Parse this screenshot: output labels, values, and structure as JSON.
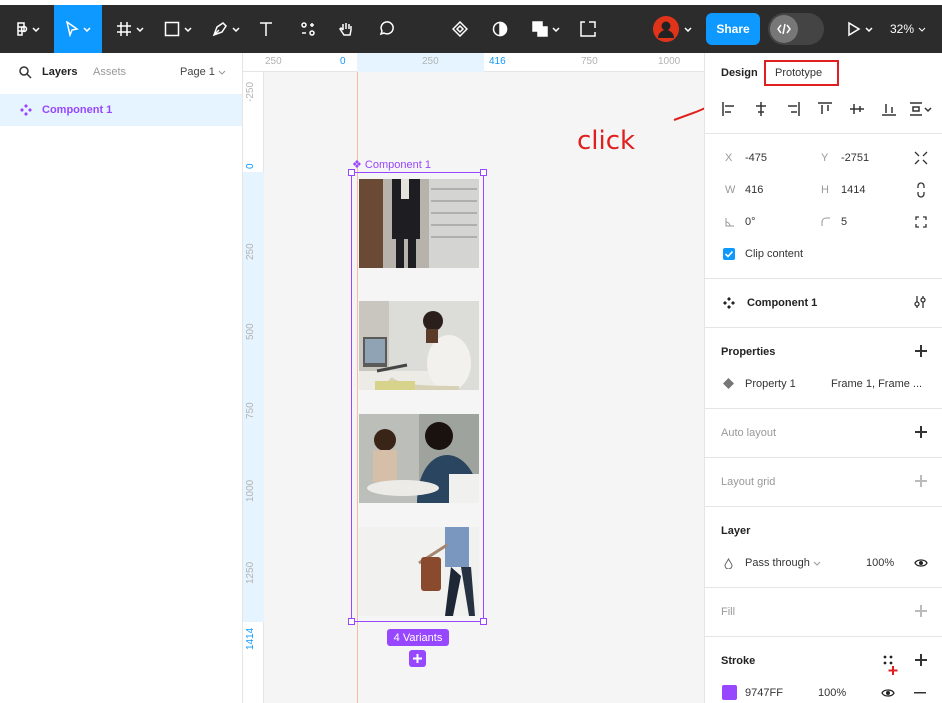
{
  "toolbar": {
    "share_label": "Share",
    "zoom": "32%"
  },
  "left_panel": {
    "tabs": {
      "layers": "Layers",
      "assets": "Assets"
    },
    "page": "Page 1",
    "layers": [
      {
        "label": "Component 1"
      }
    ]
  },
  "rulers": {
    "top": [
      "250",
      "0",
      "250",
      "416",
      "750",
      "1000"
    ],
    "left": [
      "-250",
      "0",
      "250",
      "500",
      "750",
      "1000",
      "1250",
      "1414"
    ]
  },
  "canvas": {
    "component_label": "Component 1",
    "variants_label": "4 Variants"
  },
  "annotation": {
    "text": "click",
    "color": "#e02020"
  },
  "right_panel": {
    "tabs": {
      "design": "Design",
      "prototype": "Prototype"
    },
    "frame": {
      "x_label": "X",
      "x": "-475",
      "y_label": "Y",
      "y": "-2751",
      "w_label": "W",
      "w": "416",
      "h_label": "H",
      "h": "1414",
      "rotation": "0°",
      "radius": "5",
      "clip_content": "Clip content"
    },
    "component": {
      "name": "Component 1"
    },
    "properties": {
      "title": "Properties",
      "items": [
        {
          "name": "Property 1",
          "value": "Frame 1, Frame ..."
        }
      ]
    },
    "auto_layout": "Auto layout",
    "layout_grid": "Layout grid",
    "layer": {
      "title": "Layer",
      "blend": "Pass through",
      "opacity": "100%"
    },
    "fill": "Fill",
    "stroke": {
      "title": "Stroke",
      "color": "9747FF",
      "opacity": "100%",
      "swatch": "#9747ff"
    }
  },
  "colors": {
    "accent": "#0d99ff",
    "component": "#9747ff",
    "toolbar": "#2c2c2c"
  }
}
